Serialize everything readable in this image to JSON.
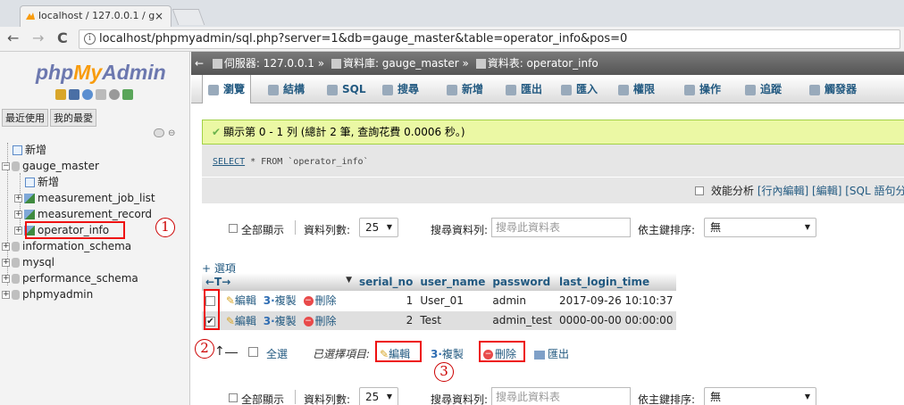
{
  "browser": {
    "tab_title": "localhost / 127.0.0.1 / g",
    "tab_close": "×",
    "back": "←",
    "forward": "→",
    "reload": "C",
    "url_info": "i",
    "url": "localhost/phpmyadmin/sql.php?server=1&db=gauge_master&table=operator_info&pos=0"
  },
  "sidebar": {
    "logo_php": "php",
    "logo_my": "My",
    "logo_admin": "Admin",
    "tabs": [
      "最近使用",
      "我的最愛"
    ],
    "link_icon": "⊖",
    "tree": [
      {
        "label": "新增",
        "type": "new"
      },
      {
        "label": "gauge_master",
        "type": "db"
      },
      {
        "label": "新增",
        "type": "new"
      },
      {
        "label": "measurement_job_list",
        "type": "table"
      },
      {
        "label": "measurement_record",
        "type": "table"
      },
      {
        "label": "operator_info",
        "type": "table"
      },
      {
        "label": "information_schema",
        "type": "db"
      },
      {
        "label": "mysql",
        "type": "db"
      },
      {
        "label": "performance_schema",
        "type": "db"
      },
      {
        "label": "phpmyadmin",
        "type": "db"
      }
    ],
    "expand_plus": "+",
    "expand_minus": "−"
  },
  "annotations": {
    "c1": "1",
    "c2": "2",
    "c3": "3"
  },
  "breadcrumb": {
    "back": "←",
    "server": "伺服器: 127.0.0.1 »",
    "database": "資料庫: gauge_master »",
    "table": "資料表: operator_info"
  },
  "top_tabs": [
    "瀏覽",
    "結構",
    "SQL",
    "搜尋",
    "新增",
    "匯出",
    "匯入",
    "權限",
    "操作",
    "追蹤",
    "觸發器"
  ],
  "message": {
    "check": "✔",
    "text": "顯示第 0 - 1 列 (總計 2 筆, 查詢花費 0.0006 秒。)"
  },
  "sql": {
    "keyword": "SELECT",
    "rest": " * FROM `operator_info`"
  },
  "sql_footer": {
    "profiling": "效能分析",
    "links": "[行內編輯] [編輯] [SQL 語句分"
  },
  "nav_controls": {
    "show_all": "全部顯示",
    "rows_label": "資料列數:",
    "rows_value": "25",
    "arrow": "▼",
    "search_label": "搜尋資料列:",
    "search_placeholder": "搜尋此資料表",
    "sort_label": "依主鍵排序:",
    "sort_value": "無"
  },
  "options_link": "+ 選項",
  "table": {
    "arrows": "←T→",
    "sort_arrow": "▼",
    "headers": [
      "serial_no",
      "user_name",
      "password",
      "last_login_time"
    ],
    "row_actions": {
      "edit": "編輯",
      "copy": "複製",
      "delete": "刪除",
      "pencil": "✎",
      "copy_icon": "3·",
      "delete_icon": "−"
    },
    "rows": [
      {
        "checked": false,
        "check_mark": "",
        "serial_no": "1",
        "user_name": "User_01",
        "password": "admin",
        "last_login_time": "2017-09-26 10:10:37"
      },
      {
        "checked": true,
        "check_mark": "✔",
        "serial_no": "2",
        "user_name": "Test",
        "password": "admin_test",
        "last_login_time": "0000-00-00 00:00:00"
      }
    ]
  },
  "bulk": {
    "arrow": "↑",
    "select_all": "全選",
    "with_selected": "已選擇項目:",
    "edit": "編輯",
    "copy": "複製",
    "delete": "刪除",
    "export": "匯出",
    "pencil": "✎",
    "copy_icon": "3·",
    "delete_icon": "−"
  },
  "colors": {
    "accent": "#235a81",
    "logo_orange": "#f89c0e",
    "annotation_red": "#e11111",
    "success_bg": "#ebf8a4"
  }
}
